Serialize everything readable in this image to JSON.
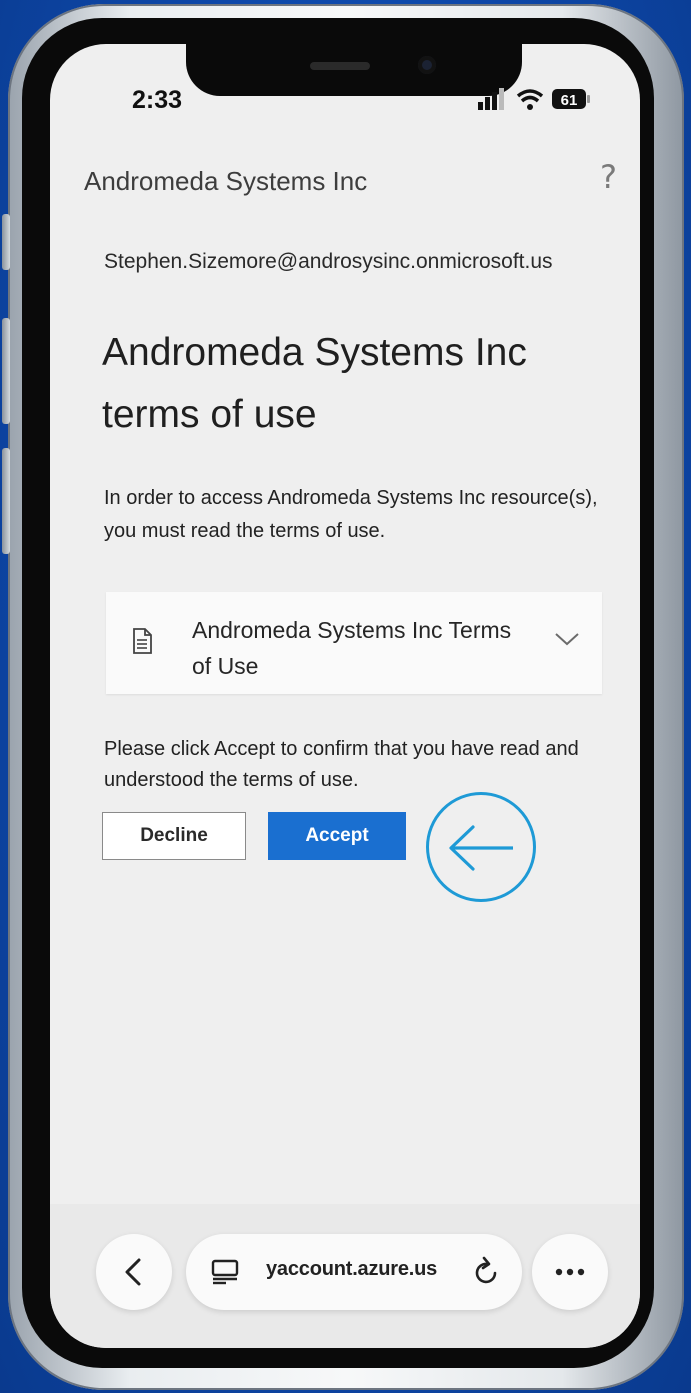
{
  "status_bar": {
    "time": "2:33",
    "battery": "61"
  },
  "header": {
    "org_name": "Andromeda Systems Inc",
    "help_icon": "?"
  },
  "account": {
    "email": "Stephen.Sizemore@androsysinc.onmicrosoft.us"
  },
  "page": {
    "title": "Andromeda Systems Inc terms of use",
    "instructions": "In order to access Andromeda Systems Inc resource(s), you must read the terms of use."
  },
  "terms_card": {
    "title": "Andromeda Systems Inc Terms of Use",
    "icon": "document-icon",
    "expand_icon": "chevron-down-icon"
  },
  "confirm": {
    "text": "Please click Accept to confirm that you have read and understood the terms of use.",
    "decline_label": "Decline",
    "accept_label": "Accept"
  },
  "browser": {
    "url": "yaccount.azure.us",
    "back_icon": "back-icon",
    "more_icon": "more-icon"
  },
  "colors": {
    "accent": "#1a6fd0",
    "callout": "#1e9ad6",
    "background": "#0d47a8"
  }
}
